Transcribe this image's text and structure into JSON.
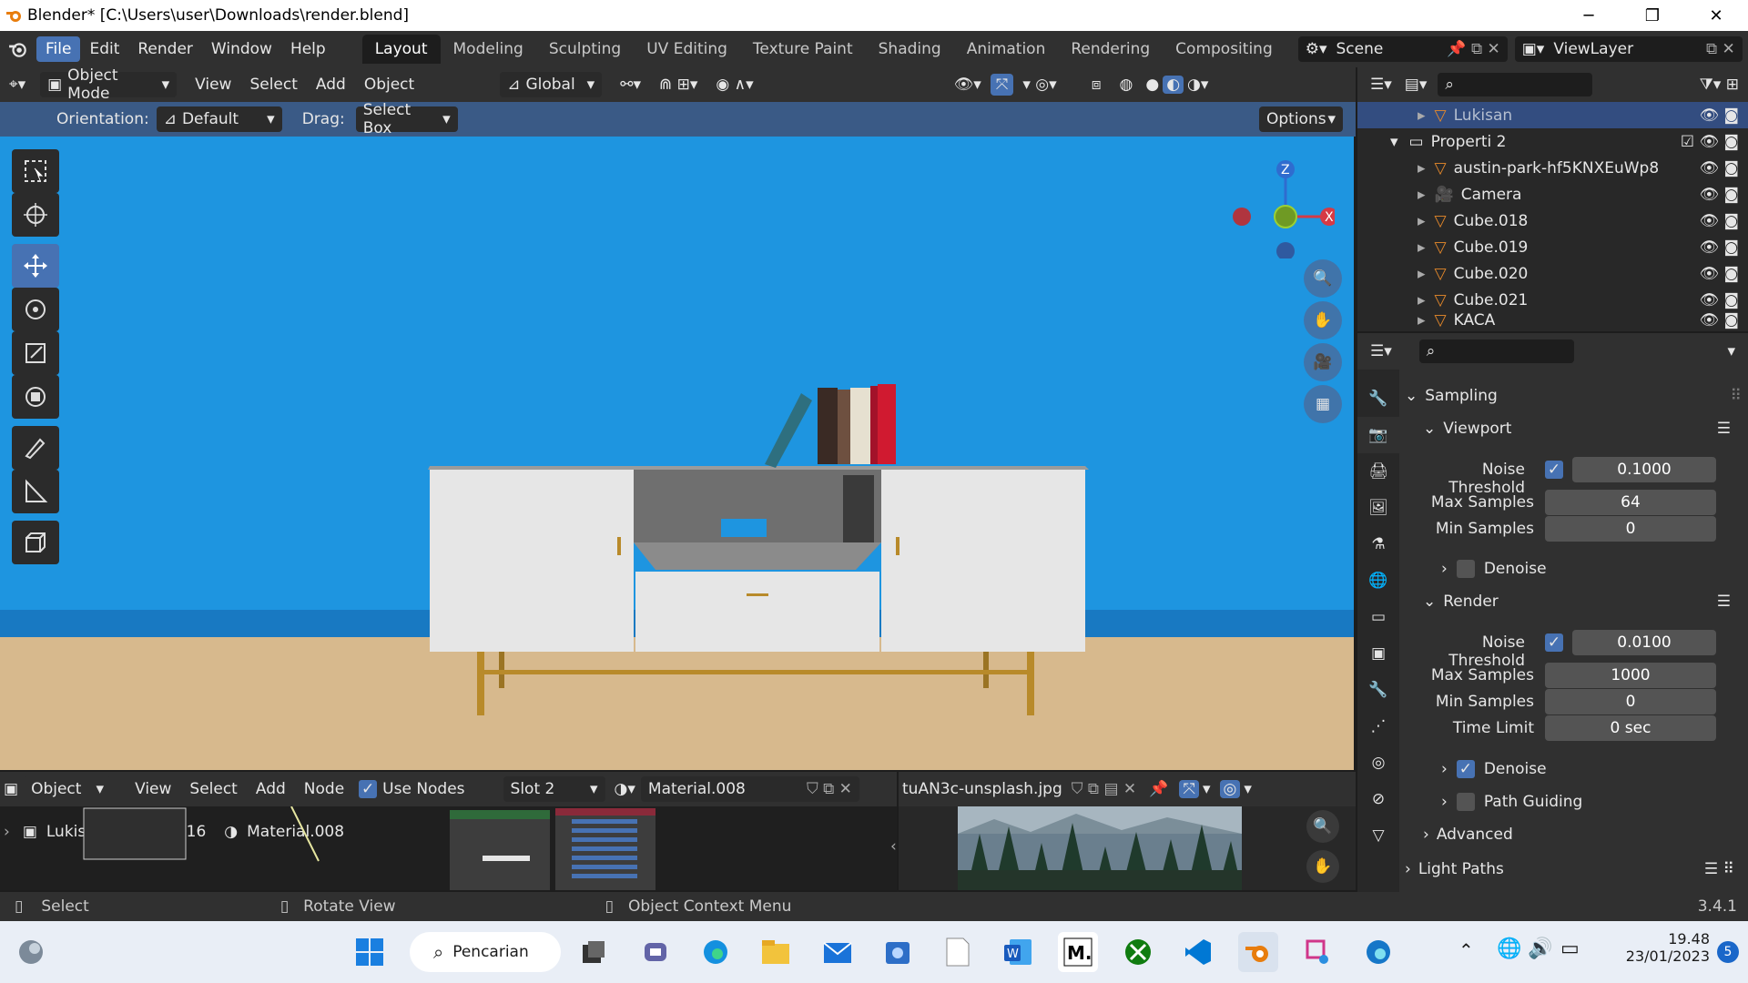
{
  "window": {
    "title": "Blender* [C:\\Users\\user\\Downloads\\render.blend]"
  },
  "menus": [
    "File",
    "Edit",
    "Render",
    "Window",
    "Help"
  ],
  "workspaces": [
    "Layout",
    "Modeling",
    "Sculpting",
    "UV Editing",
    "Texture Paint",
    "Shading",
    "Animation",
    "Rendering",
    "Compositing"
  ],
  "scene": {
    "label": "Scene",
    "view_layer": "ViewLayer"
  },
  "viewport_header": {
    "mode": "Object Mode",
    "view": "View",
    "select": "Select",
    "add": "Add",
    "object": "Object",
    "transform": "Global"
  },
  "tool_options": {
    "orientation_label": "Orientation:",
    "orientation_value": "Default",
    "drag_label": "Drag:",
    "drag_value": "Select Box",
    "options": "Options"
  },
  "outliner": {
    "items": [
      {
        "name": "Lukisan",
        "selected": true
      },
      {
        "name": "Properti 2"
      },
      {
        "name": "austin-park-hf5KNXEuWp8"
      },
      {
        "name": "Camera"
      },
      {
        "name": "Cube.018"
      },
      {
        "name": "Cube.019"
      },
      {
        "name": "Cube.020"
      },
      {
        "name": "Cube.021"
      },
      {
        "name": "KACA"
      }
    ]
  },
  "properties": {
    "sampling": "Sampling",
    "viewport": {
      "title": "Viewport",
      "noise_threshold_label": "Noise Threshold",
      "noise_threshold": "0.1000",
      "max_samples_label": "Max Samples",
      "max_samples": "64",
      "min_samples_label": "Min Samples",
      "min_samples": "0",
      "denoise": "Denoise"
    },
    "render": {
      "title": "Render",
      "noise_threshold_label": "Noise Threshold",
      "noise_threshold": "0.0100",
      "max_samples_label": "Max Samples",
      "max_samples": "1000",
      "min_samples_label": "Min Samples",
      "min_samples": "0",
      "time_limit_label": "Time Limit",
      "time_limit": "0 sec",
      "denoise": "Denoise"
    },
    "path_guiding": "Path Guiding",
    "advanced": "Advanced",
    "light_paths": "Light Paths"
  },
  "node_editor": {
    "type": "Object",
    "view": "View",
    "select": "Select",
    "add": "Add",
    "node": "Node",
    "use_nodes": "Use Nodes",
    "slot": "Slot 2",
    "material": "Material.008",
    "breadcrumb": {
      "object": "Lukisan",
      "mesh": "Cube.016",
      "material": "Material.008"
    }
  },
  "image_editor": {
    "image": "tuAN3c-unsplash.jpg"
  },
  "status": {
    "select": "Select",
    "rotate": "Rotate View",
    "context": "Object Context Menu",
    "version": "3.4.1"
  },
  "taskbar": {
    "search": "Pencarian",
    "time": "19.48",
    "date": "23/01/2023",
    "badge": "5"
  },
  "colors": {
    "accent": "#4772b3",
    "sky": "#1e95e0",
    "floor": "#d7b98d"
  }
}
